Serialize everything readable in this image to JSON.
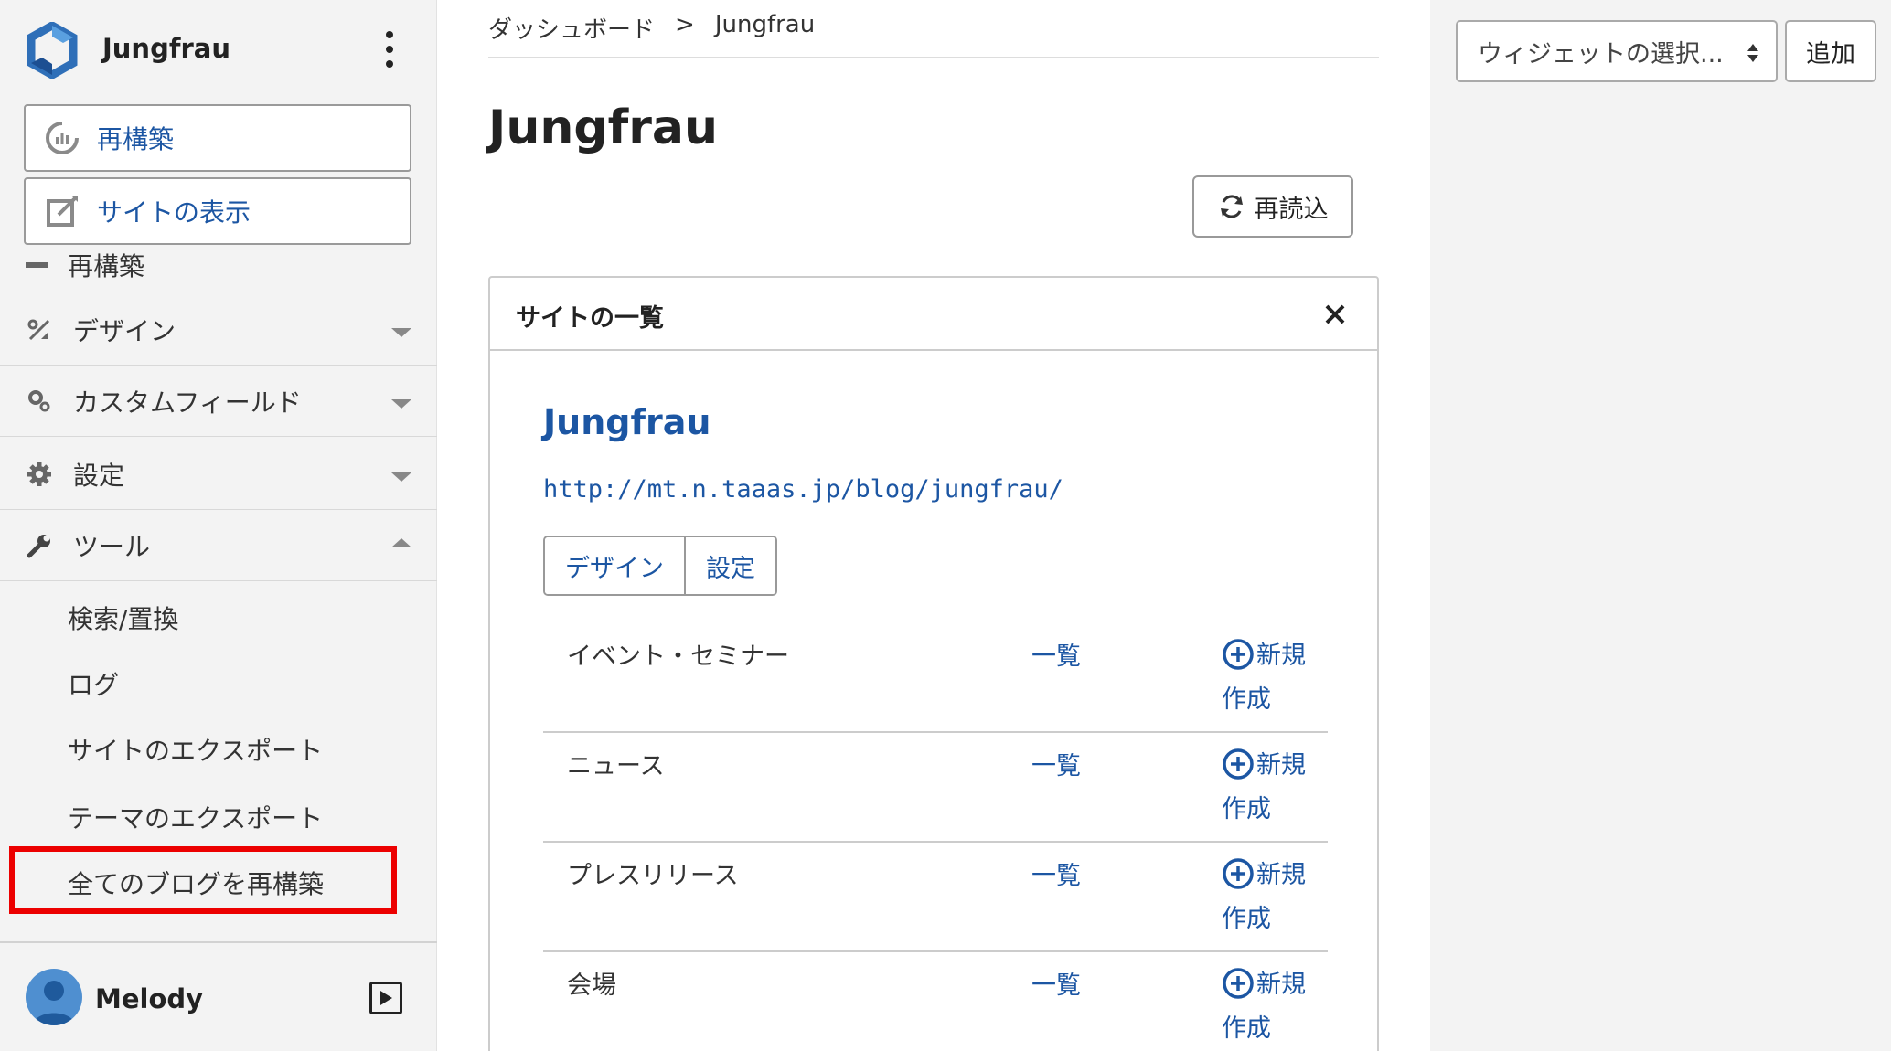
{
  "site": {
    "name": "Jungfrau"
  },
  "sidebar": {
    "quick_actions": [
      {
        "label": "再構築",
        "icon": "rebuild-icon"
      },
      {
        "label": "サイトの表示",
        "icon": "external-edit-icon"
      }
    ],
    "clipped_item": {
      "label": "再構築"
    },
    "nav": [
      {
        "label": "デザイン",
        "icon": "design-icon",
        "state": "collapsed"
      },
      {
        "label": "カスタムフィールド",
        "icon": "custom-fields-icon",
        "state": "collapsed"
      },
      {
        "label": "設定",
        "icon": "gear-icon",
        "state": "collapsed"
      },
      {
        "label": "ツール",
        "icon": "wrench-icon",
        "state": "expanded"
      }
    ],
    "tools_submenu": [
      {
        "label": "検索/置換"
      },
      {
        "label": "ログ"
      },
      {
        "label": "サイトのエクスポート"
      },
      {
        "label": "テーマのエクスポート"
      },
      {
        "label": "全てのブログを再構築",
        "highlighted": true
      }
    ],
    "user": {
      "name": "Melody"
    }
  },
  "breadcrumb": {
    "items": [
      "ダッシュボード",
      "Jungfrau"
    ],
    "separator": ">"
  },
  "main": {
    "title": "Jungfrau",
    "reload_label": "再読込",
    "widget": {
      "title": "サイトの一覧",
      "site_title": "Jungfrau",
      "site_url": "http://mt.n.taaas.jp/blog/jungfrau/",
      "buttons": [
        "デザイン",
        "設定"
      ],
      "content_types": [
        {
          "name": "イベント・セミナー",
          "list_label": "一覧",
          "new_label": "新規作成"
        },
        {
          "name": "ニュース",
          "list_label": "一覧",
          "new_label": "新規作成"
        },
        {
          "name": "プレスリリース",
          "list_label": "一覧",
          "new_label": "新規作成"
        },
        {
          "name": "会場",
          "list_label": "一覧",
          "new_label": "新規作成"
        }
      ]
    }
  },
  "right_panel": {
    "widget_select_label": "ウィジェットの選択...",
    "add_label": "追加"
  },
  "colors": {
    "accent": "#1c56a3",
    "highlight": "#ec0000",
    "sidebar_bg": "#f3f3f3"
  }
}
